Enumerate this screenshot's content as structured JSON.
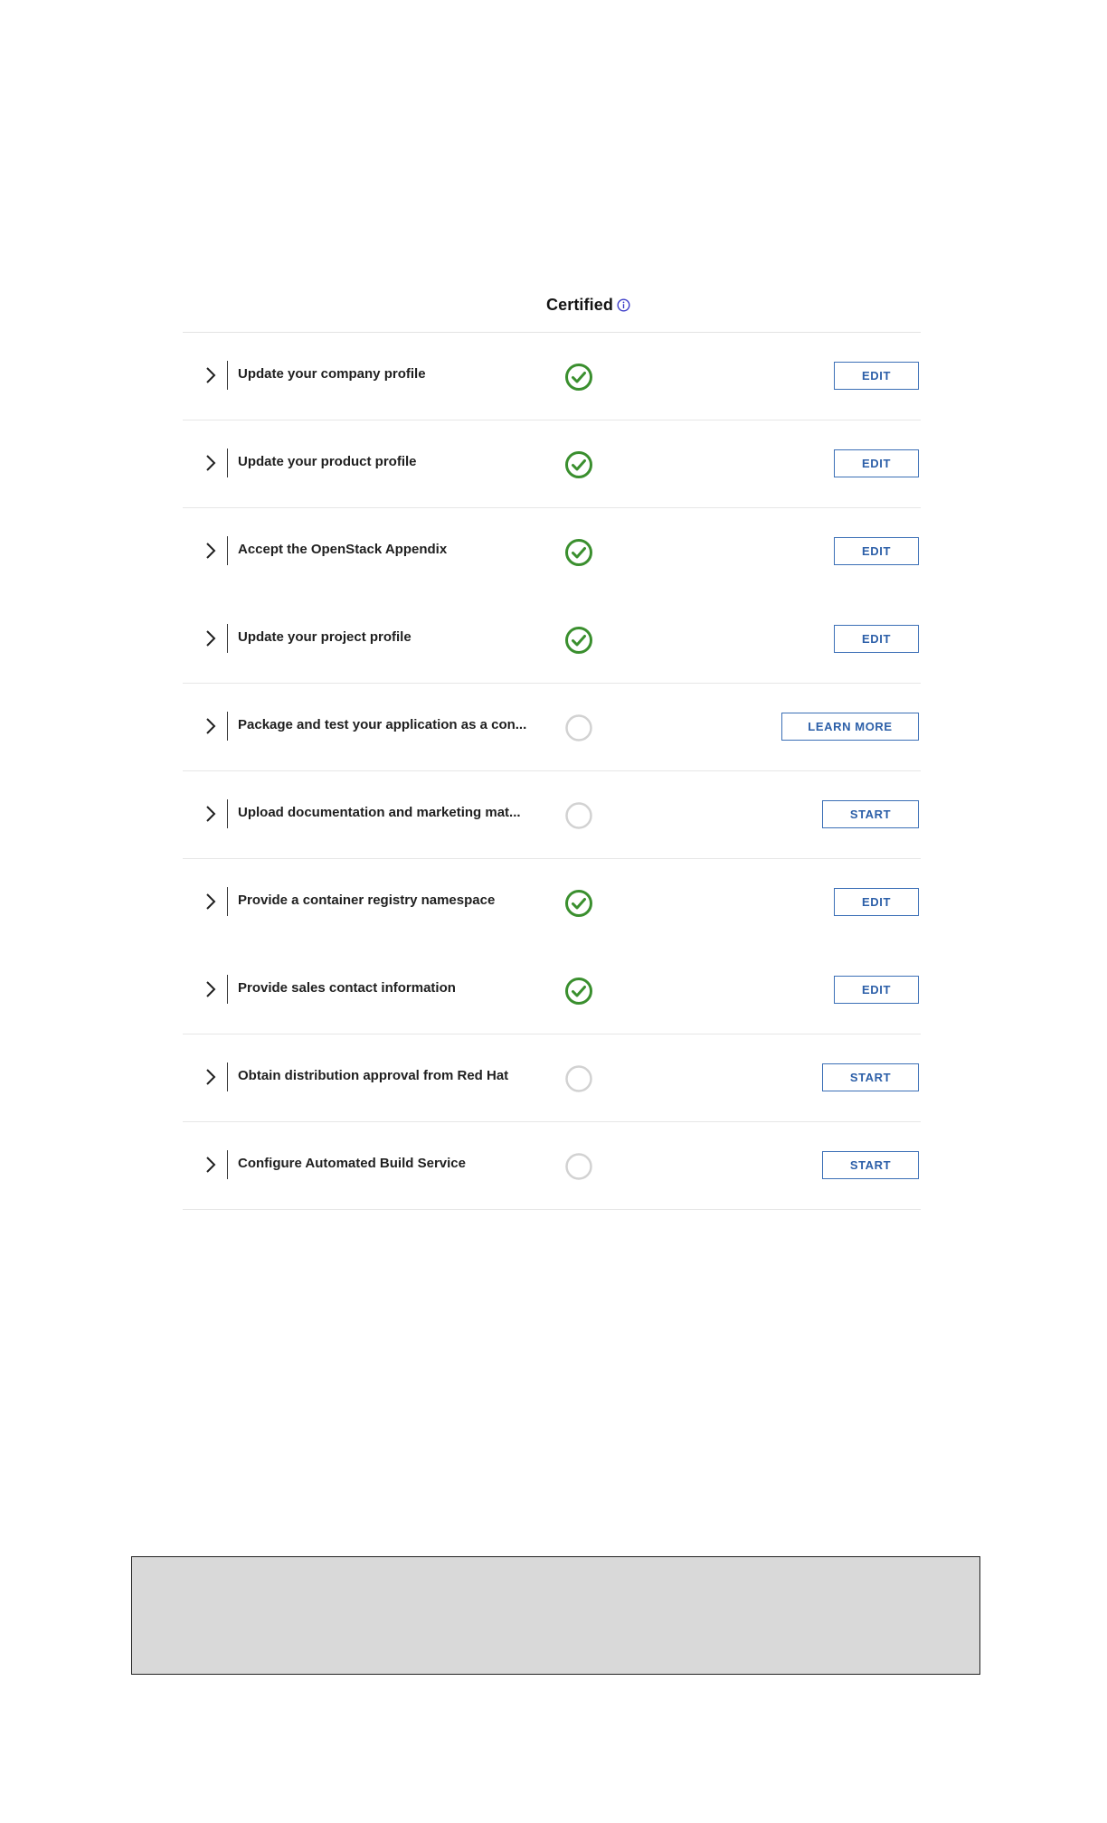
{
  "header": {
    "title": "Certified",
    "info_icon": "info-circle-icon"
  },
  "colors": {
    "complete": "#3a8f2e",
    "pending": "#d2d2d2",
    "button": "#2c5fa8"
  },
  "tasks": [
    {
      "label": "Update your company profile",
      "status": "complete",
      "action": "EDIT"
    },
    {
      "label": "Update your product profile",
      "status": "complete",
      "action": "EDIT"
    },
    {
      "label": "Accept the OpenStack Appendix",
      "status": "complete",
      "action": "EDIT"
    },
    {
      "label": "Update your project profile",
      "status": "complete",
      "action": "EDIT"
    },
    {
      "label": "Package and test your application as a con...",
      "status": "incomplete",
      "action": "LEARN MORE"
    },
    {
      "label": "Upload documentation and marketing mat...",
      "status": "incomplete",
      "action": "START"
    },
    {
      "label": "Provide a container registry namespace",
      "status": "complete",
      "action": "EDIT"
    },
    {
      "label": "Provide sales contact information",
      "status": "complete",
      "action": "EDIT"
    },
    {
      "label": "Obtain distribution approval from Red Hat",
      "status": "incomplete",
      "action": "START"
    },
    {
      "label": "Configure Automated Build Service",
      "status": "incomplete",
      "action": "START"
    }
  ]
}
